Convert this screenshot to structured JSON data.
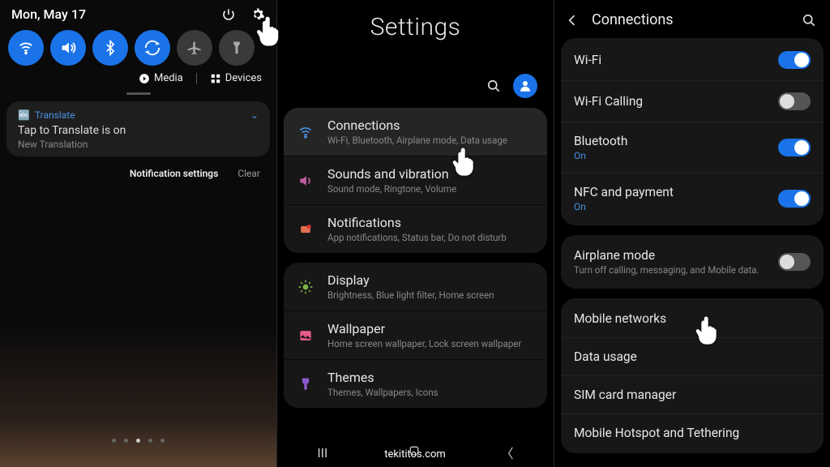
{
  "watermark": "tekititos.com",
  "pane1": {
    "date": "Mon, May 17",
    "qs": [
      "wifi",
      "sound",
      "bluetooth",
      "rotate",
      "airplane",
      "flashlight"
    ],
    "media_label": "Media",
    "devices_label": "Devices",
    "notif": {
      "app": "Translate",
      "title": "Tap to Translate is on",
      "sub": "New Translation"
    },
    "footer": {
      "settings": "Notification settings",
      "clear": "Clear"
    }
  },
  "pane2": {
    "title": "Settings",
    "groups": [
      [
        {
          "key": "connections",
          "title": "Connections",
          "sub": "Wi-Fi, Bluetooth, Airplane mode, Data usage",
          "icon": "wifi",
          "color": "#4a90e2",
          "hl": true
        },
        {
          "key": "sounds",
          "title": "Sounds and vibration",
          "sub": "Sound mode, Ringtone, Volume",
          "icon": "sound",
          "color": "#c45da0"
        },
        {
          "key": "notifications",
          "title": "Notifications",
          "sub": "App notifications, Status bar, Do not disturb",
          "icon": "notif",
          "color": "#e07050"
        }
      ],
      [
        {
          "key": "display",
          "title": "Display",
          "sub": "Brightness, Blue light filter, Home screen",
          "icon": "display",
          "color": "#7cb342"
        },
        {
          "key": "wallpaper",
          "title": "Wallpaper",
          "sub": "Home screen wallpaper, Lock screen wallpaper",
          "icon": "wallpaper",
          "color": "#e85a8a"
        },
        {
          "key": "themes",
          "title": "Themes",
          "sub": "Themes, Wallpapers, Icons",
          "icon": "themes",
          "color": "#8a5acb"
        }
      ]
    ]
  },
  "pane3": {
    "title": "Connections",
    "groups": [
      [
        {
          "title": "Wi-Fi",
          "toggle": "on"
        },
        {
          "title": "Wi-Fi Calling",
          "toggle": "off"
        },
        {
          "title": "Bluetooth",
          "sub": "On",
          "toggle": "on"
        },
        {
          "title": "NFC and payment",
          "sub": "On",
          "toggle": "on"
        }
      ],
      [
        {
          "title": "Airplane mode",
          "subgrey": "Turn off calling, messaging, and Mobile data.",
          "toggle": "off"
        }
      ],
      [
        {
          "title": "Mobile networks"
        },
        {
          "title": "Data usage"
        },
        {
          "title": "SIM card manager"
        },
        {
          "title": "Mobile Hotspot and Tethering"
        }
      ]
    ]
  }
}
